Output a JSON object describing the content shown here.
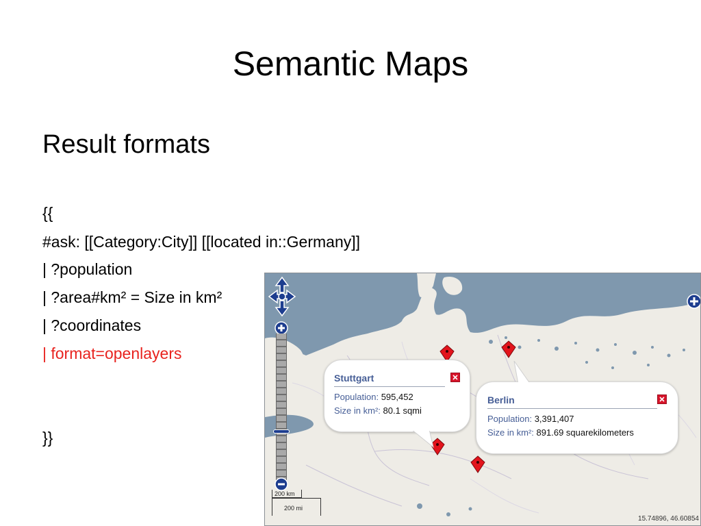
{
  "slide": {
    "title": "Semantic Maps",
    "subtitle": "Result formats",
    "code_lines": [
      "{{",
      "#ask: [[Category:City]] [[located in::Germany]]",
      "| ?population",
      "| ?area#km² = Size in km²",
      "| ?coordinates",
      "| format=openlayers",
      "}}"
    ]
  },
  "map": {
    "popups": [
      {
        "title": "Stuttgart",
        "line1_label": "Population:",
        "line1_value": "595,452",
        "line2_label": "Size in km²:",
        "line2_value": "80.1 sqmi"
      },
      {
        "title": "Berlin",
        "line1_label": "Population:",
        "line1_value": "3,391,407",
        "line2_label": "Size in km²:",
        "line2_value": "891.69 squarekilometers"
      }
    ],
    "scale_top": "200 km",
    "scale_bottom": "200 mi",
    "coordinates": "15.74896, 46.60854",
    "icons": {
      "pan": "pan-control-icon",
      "zoom_in": "zoom-in-icon",
      "zoom_out": "zoom-out-icon",
      "layer_switcher": "layer-switcher-icon",
      "marker": "map-marker-icon",
      "close": "close-icon"
    },
    "colors": {
      "water": "#7f98ae",
      "land": "#eeece6",
      "marker": "#e3141c",
      "popup_text": "#465e96",
      "control": "#1d3d8f"
    }
  }
}
